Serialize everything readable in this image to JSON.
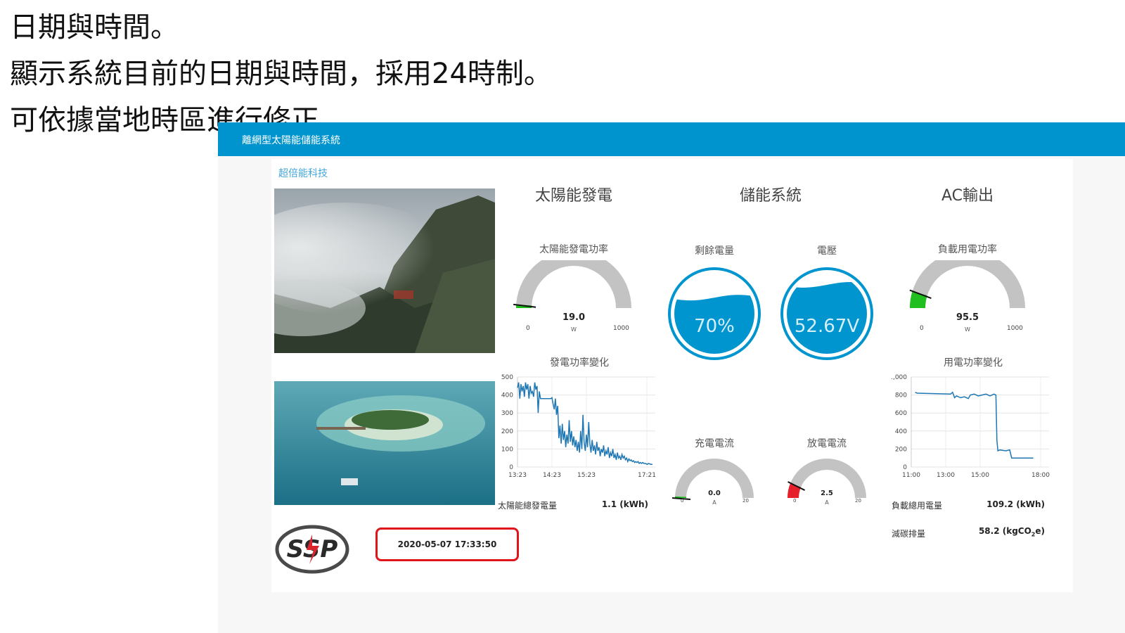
{
  "caption": {
    "line1": "日期與時間。",
    "line2": "顯示系統目前的日期與時間，採用24時制。",
    "line3": "可依據當地時區進行修正。"
  },
  "app": {
    "title": "離網型太陽能儲能系統",
    "company": "超倍能科技"
  },
  "sections": {
    "solar": "太陽能發電",
    "storage": "儲能系統",
    "ac": "AC輸出"
  },
  "gauges": {
    "solar_power": {
      "label": "太陽能發電功率",
      "value": "19.0",
      "unit": "W",
      "min": "0",
      "max": "1000",
      "level": 0.019,
      "color": "#1fbf1f"
    },
    "soc": {
      "label": "剩餘電量",
      "value": "70%",
      "level": 0.7
    },
    "voltage": {
      "label": "電壓",
      "value": "52.67V",
      "level": 0.86
    },
    "load_power": {
      "label": "負載用電功率",
      "value": "95.5",
      "unit": "W",
      "min": "0",
      "max": "1000",
      "level": 0.0955,
      "color": "#1fbf1f"
    },
    "charge_current": {
      "label": "充電電流",
      "value": "0.0",
      "unit": "A",
      "min": "0",
      "max": "20",
      "level": 0.0,
      "color": "#1fbf1f"
    },
    "discharge_current": {
      "label": "放電電流",
      "value": "2.5",
      "unit": "A",
      "min": "0",
      "max": "20",
      "level": 0.125,
      "color": "#e5202a"
    }
  },
  "stats": {
    "solar_total_label": "太陽能總發電量",
    "solar_total_value": "1.1 (kWh)",
    "load_total_label": "負載總用電量",
    "load_total_value": "109.2 (kWh)",
    "carbon_label": "減碳排量",
    "carbon_value": "58.2 (kgCO",
    "carbon_sub": "2",
    "carbon_suffix": "e)"
  },
  "clock": {
    "datetime": "2020-05-07 17:33:50"
  },
  "logo": {
    "text": "SSP"
  },
  "chart_data": [
    {
      "type": "line",
      "title": "發電功率變化",
      "x_ticks": [
        "13:23",
        "14:23",
        "15:23",
        "17:21"
      ],
      "y_ticks": [
        "500",
        "400",
        "300",
        "200",
        "100",
        "0"
      ],
      "ylim": [
        0,
        500
      ],
      "xlim": [
        0,
        240
      ],
      "x": [
        0,
        2,
        4,
        6,
        8,
        10,
        12,
        14,
        16,
        18,
        20,
        22,
        24,
        26,
        28,
        30,
        32,
        34,
        36,
        38,
        40,
        55,
        58,
        60,
        62,
        64,
        66,
        68,
        70,
        72,
        74,
        76,
        78,
        80,
        82,
        84,
        86,
        88,
        90,
        92,
        94,
        96,
        98,
        100,
        102,
        104,
        106,
        108,
        110,
        112,
        114,
        116,
        118,
        120,
        122,
        124,
        126,
        128,
        130,
        132,
        134,
        136,
        138,
        140,
        142,
        144,
        146,
        148,
        150,
        152,
        154,
        156,
        158,
        160,
        162,
        164,
        166,
        168,
        170,
        172,
        174,
        176,
        178,
        180,
        182,
        184,
        186,
        188,
        190,
        192,
        194,
        196,
        198,
        200,
        202,
        204,
        206,
        208,
        210,
        212,
        214,
        216,
        218,
        220,
        222,
        224,
        226,
        228,
        230,
        232,
        235
      ],
      "y": [
        440,
        470,
        380,
        460,
        420,
        450,
        390,
        470,
        430,
        460,
        380,
        450,
        410,
        420,
        390,
        470,
        430,
        450,
        300,
        420,
        380,
        380,
        380,
        385,
        350,
        320,
        380,
        290,
        340,
        160,
        230,
        130,
        240,
        150,
        200,
        110,
        180,
        130,
        260,
        140,
        200,
        120,
        170,
        110,
        150,
        90,
        140,
        80,
        200,
        100,
        290,
        140,
        90,
        180,
        110,
        250,
        130,
        80,
        150,
        90,
        120,
        70,
        140,
        90,
        110,
        60,
        100,
        80,
        120,
        60,
        90,
        70,
        110,
        50,
        80,
        60,
        100,
        50,
        70,
        40,
        80,
        50,
        60,
        40,
        70,
        50,
        60,
        40,
        50,
        30,
        45,
        35,
        40,
        30,
        35,
        25,
        30,
        25,
        30,
        20,
        25,
        20,
        25,
        20,
        20,
        18,
        15,
        20,
        18,
        15,
        15
      ]
    },
    {
      "type": "line",
      "title": "用電功率變化",
      "x_ticks": [
        "11:00",
        "13:00",
        "15:00",
        "18:00"
      ],
      "y_ticks": [
        "1,000",
        "800",
        "600",
        "400",
        "200",
        "0"
      ],
      "ylim": [
        0,
        1000
      ],
      "xlim": [
        0,
        7
      ],
      "x": [
        0.2,
        0.3,
        2.0,
        2.1,
        2.2,
        2.3,
        2.5,
        2.7,
        2.9,
        3.0,
        3.2,
        3.4,
        3.6,
        3.8,
        4.0,
        4.2,
        4.3,
        4.35,
        4.4,
        4.5,
        4.8,
        5.0,
        5.1,
        6.2
      ],
      "y": [
        830,
        820,
        810,
        830,
        770,
        790,
        770,
        780,
        760,
        800,
        810,
        790,
        800,
        810,
        790,
        810,
        800,
        300,
        180,
        190,
        180,
        190,
        100,
        100
      ]
    }
  ]
}
